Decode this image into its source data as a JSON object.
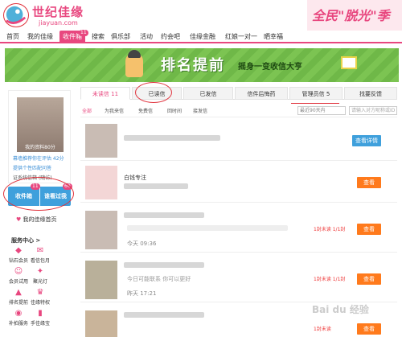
{
  "header": {
    "logo_cn": "世纪佳缘",
    "logo_en": "jiayuan.com",
    "promo": "全民\"脱光\"季"
  },
  "nav": {
    "items": [
      "首页",
      "我的佳缘",
      "收件箱",
      "搜索",
      "俱乐部",
      "活动",
      "约会吧",
      "佳缘金融",
      "红娘一对一",
      "晒幸福"
    ],
    "inbox_badge": "11"
  },
  "banner": {
    "title": "排名提前",
    "subtitle": "摇身一变收信大亨"
  },
  "sidebar": {
    "avatar_caption": "我的资料80分",
    "link1": "幕墙推荐你在评估 42分",
    "link2": "提供个性匹配问答",
    "link3": "证系统信箱  (随访)",
    "inbox_label": "收件箱",
    "inbox_count": "11",
    "visitors_label": "谁看过我",
    "visitors_count": "60",
    "home_link": "我的佳缘首页",
    "services_title": "服务中心 >",
    "services": [
      "钻石会员",
      "看信包月",
      "会员试用",
      "聚光灯",
      "排名提前",
      "佳缘特权",
      "补拍服务",
      "手佳缘宝"
    ]
  },
  "tabs": {
    "items": [
      "未读信 11",
      "已读信",
      "已发信",
      "信件后悔药",
      "管理员信 5",
      "找要反馈"
    ]
  },
  "filters": {
    "items": [
      "全部",
      "为我来信",
      "免费信",
      "回时间",
      "接发信"
    ],
    "sort": "最近90天内",
    "search_placeholder": "请输入对方昵称或ID"
  },
  "messages": [
    {
      "text": "",
      "time": "",
      "status": "",
      "button": "查看详情"
    },
    {
      "text": "白钱专注",
      "time": "",
      "status": "",
      "button": "查看"
    },
    {
      "text": "",
      "time": "今天 09:36",
      "status": "1封未读 1/1封",
      "button": "查看"
    },
    {
      "text": "今日可能联系  你可以更好",
      "time": "昨天 17:21",
      "status": "1封未读 1/1封",
      "button": "查看"
    },
    {
      "text": "",
      "time": "",
      "status": "1封未读",
      "button": "查看"
    }
  ],
  "watermark": "Bai du 经验",
  "colors": {
    "accent": "#e8477f",
    "blue": "#3fa0dc",
    "orange": "#ff7a1c",
    "green": "#6fb848"
  }
}
